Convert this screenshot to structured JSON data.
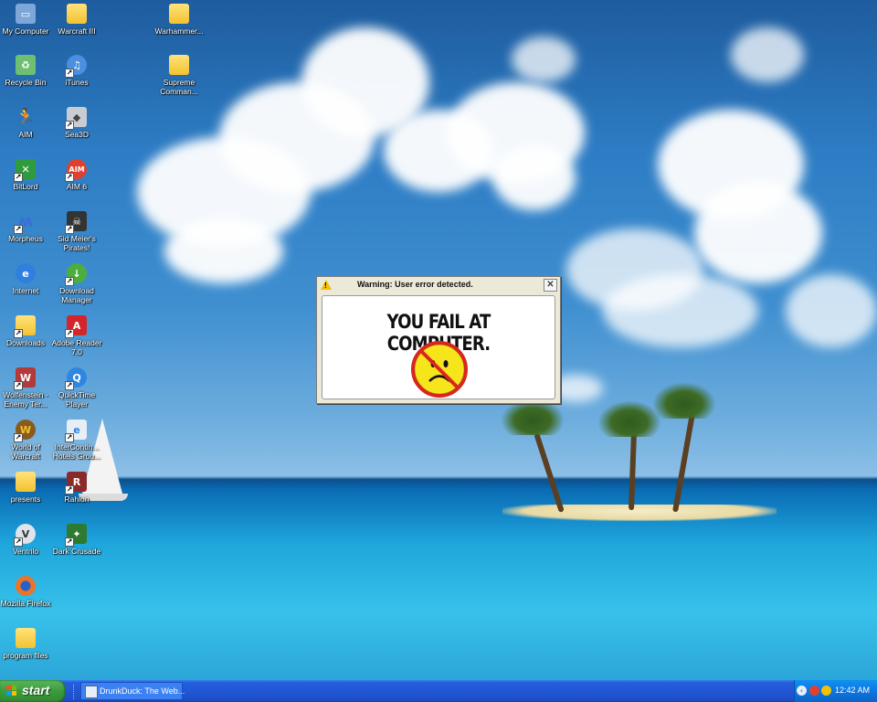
{
  "desktop": {
    "icons": [
      {
        "label": "My Computer",
        "icon": "my-computer-icon",
        "color": "#7fa6d8"
      },
      {
        "label": "Recycle Bin",
        "icon": "recycle-bin-icon",
        "color": "#6fbf73"
      },
      {
        "label": "AIM",
        "icon": "aim-running-man-icon",
        "color": "#f2b000"
      },
      {
        "label": "BitLord",
        "icon": "bitlord-icon",
        "color": "#2e9b3c"
      },
      {
        "label": "Morpheus",
        "icon": "morpheus-icon",
        "color": "#3a6fd6"
      },
      {
        "label": "Internet",
        "icon": "internet-explorer-icon",
        "color": "#2f7fe0"
      },
      {
        "label": "Downloads",
        "icon": "downloads-folder-icon",
        "color": "#f3c230"
      },
      {
        "label": "Wolfenstein -\nEnemy Ter...",
        "icon": "wolfenstein-icon",
        "color": "#b33a3a"
      },
      {
        "label": "World of\nWarcraft",
        "icon": "world-of-warcraft-icon",
        "color": "#8a5a1c"
      },
      {
        "label": "presents",
        "icon": "folder-icon",
        "color": "#f3c230"
      },
      {
        "label": "Ventrilo",
        "icon": "ventrilo-icon",
        "color": "#dfe3ea"
      },
      {
        "label": "Mozilla Firefox",
        "icon": "firefox-icon",
        "color": "#e8752a"
      },
      {
        "label": "program files",
        "icon": "folder-icon",
        "color": "#f3c230"
      },
      {
        "label": "Warcraft III",
        "icon": "folder-icon",
        "color": "#f3c230"
      },
      {
        "label": "iTunes",
        "icon": "itunes-icon",
        "color": "#4a8fe0"
      },
      {
        "label": "Sea3D",
        "icon": "sea3d-icon",
        "color": "#c9cdd3"
      },
      {
        "label": "AIM 6",
        "icon": "aim6-icon",
        "color": "#e0412f"
      },
      {
        "label": "Sid Meier's\nPirates!",
        "icon": "pirates-icon",
        "color": "#333333"
      },
      {
        "label": "Download\nManager",
        "icon": "download-manager-icon",
        "color": "#4cae3c"
      },
      {
        "label": "Adobe Reader\n7.0",
        "icon": "adobe-reader-icon",
        "color": "#d4262a"
      },
      {
        "label": "QuickTime\nPlayer",
        "icon": "quicktime-icon",
        "color": "#2f86e0"
      },
      {
        "label": "InterContin...\nHotels Grou...",
        "icon": "document-icon",
        "color": "#e8eef6"
      },
      {
        "label": "Rahlon",
        "icon": "rahlon-icon",
        "color": "#8c2a2a"
      },
      {
        "label": "Dark Crusade",
        "icon": "dark-crusade-icon",
        "color": "#2e7a2e"
      },
      {
        "label": "Warhammer...",
        "icon": "folder-icon",
        "color": "#f3c230"
      },
      {
        "label": "Supreme\nComman...",
        "icon": "folder-icon",
        "color": "#f3c230"
      }
    ]
  },
  "dialog": {
    "title": "Warning: User error detected.",
    "close_label": "✕",
    "warning_glyph": "!",
    "message": "YOU FAIL AT COMPUTER."
  },
  "taskbar": {
    "start_label": "start",
    "task_label": "DrunkDuck: The Web...",
    "tray_expand_glyph": "‹",
    "clock": "12:42 AM"
  },
  "colors": {
    "taskbar_blue": "#245edb",
    "start_green": "#3c9c3c",
    "tray_blue": "#0c77de",
    "dialog_face": "#ece9d8",
    "prohibition_red": "#d8261f",
    "smiley_yellow": "#f7e51c"
  }
}
